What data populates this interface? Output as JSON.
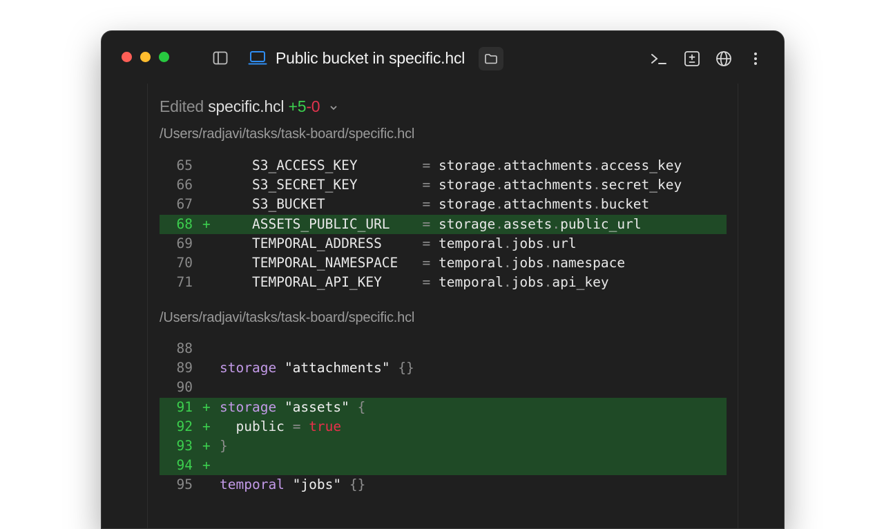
{
  "window": {
    "title": "Public bucket in specific.hcl"
  },
  "edit_summary": {
    "label": "Edited",
    "filename": "specific.hcl",
    "added": "+5",
    "removed": "-0"
  },
  "hunks": [
    {
      "path": "/Users/radjavi/tasks/task-board/specific.hcl",
      "lines": [
        {
          "num": "65",
          "marker": "",
          "key": "S3_ACCESS_KEY",
          "eq": "=",
          "ref": [
            "storage",
            "attachments",
            "access_key"
          ]
        },
        {
          "num": "66",
          "marker": "",
          "key": "S3_SECRET_KEY",
          "eq": "=",
          "ref": [
            "storage",
            "attachments",
            "secret_key"
          ]
        },
        {
          "num": "67",
          "marker": "",
          "key": "S3_BUCKET",
          "eq": "=",
          "ref": [
            "storage",
            "attachments",
            "bucket"
          ]
        },
        {
          "num": "68",
          "marker": "+",
          "key": "ASSETS_PUBLIC_URL",
          "eq": "=",
          "ref": [
            "storage",
            "assets",
            "public_url"
          ]
        },
        {
          "num": "69",
          "marker": "",
          "key": "TEMPORAL_ADDRESS",
          "eq": "=",
          "ref": [
            "temporal",
            "jobs",
            "url"
          ]
        },
        {
          "num": "70",
          "marker": "",
          "key": "TEMPORAL_NAMESPACE",
          "eq": "=",
          "ref": [
            "temporal",
            "jobs",
            "namespace"
          ]
        },
        {
          "num": "71",
          "marker": "",
          "key": "TEMPORAL_API_KEY",
          "eq": "=",
          "ref": [
            "temporal",
            "jobs",
            "api_key"
          ]
        }
      ]
    },
    {
      "path": "/Users/radjavi/tasks/task-board/specific.hcl",
      "lines": [
        {
          "num": "88",
          "marker": ""
        },
        {
          "num": "89",
          "marker": "",
          "keyword": "storage",
          "string": "\"attachments\"",
          "tail": "{}"
        },
        {
          "num": "90",
          "marker": ""
        },
        {
          "num": "91",
          "marker": "+",
          "keyword": "storage",
          "string": "\"assets\"",
          "tail": "{"
        },
        {
          "num": "92",
          "marker": "+",
          "attr": "public",
          "eq": "=",
          "value": "true"
        },
        {
          "num": "93",
          "marker": "+",
          "tail": "}"
        },
        {
          "num": "94",
          "marker": "+"
        },
        {
          "num": "95",
          "marker": "",
          "keyword": "temporal",
          "string": "\"jobs\"",
          "tail": "{}"
        }
      ]
    }
  ],
  "icons": {
    "sidebar": "sidebar-toggle-icon",
    "laptop": "laptop-icon",
    "folder": "folder-icon",
    "terminal": "terminal-icon",
    "diff": "diff-icon",
    "globe": "globe-icon",
    "more": "more-vertical-icon",
    "chevron": "chevron-down-icon"
  },
  "colors": {
    "added": "#3ccf4e",
    "removed": "#e0334d",
    "added_line_bg": "#1f4a26",
    "keyword": "#c39ae8",
    "boolean": "#e8304a"
  }
}
